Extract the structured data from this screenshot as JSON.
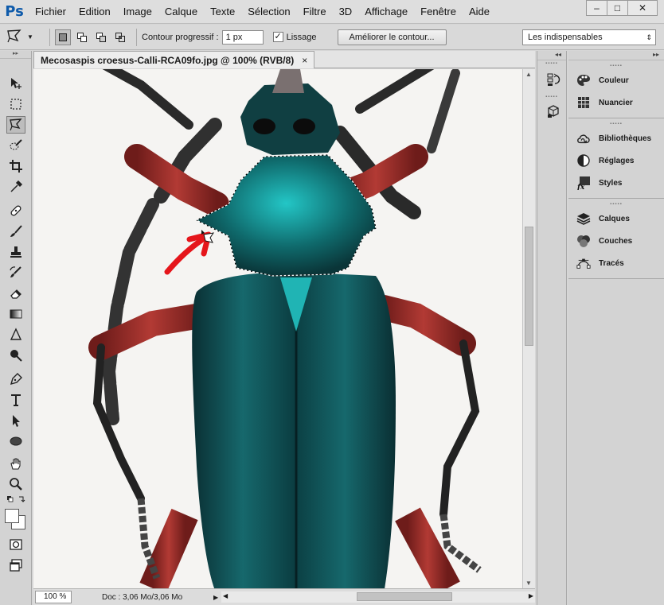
{
  "app": {
    "logo": "Ps"
  },
  "menu": [
    "Fichier",
    "Edition",
    "Image",
    "Calque",
    "Texte",
    "Sélection",
    "Filtre",
    "3D",
    "Affichage",
    "Fenêtre",
    "Aide"
  ],
  "window_controls": {
    "minimize": "–",
    "maximize": "□",
    "close": "✕"
  },
  "options": {
    "feather_label": "Contour progressif :",
    "feather_value": "1 px",
    "antialias_label": "Lissage",
    "antialias_checked": "✓",
    "refine_edge_label": "Améliorer le contour...",
    "workspace": "Les indispensables"
  },
  "document": {
    "tab_title": "Mecosaspis croesus-Calli-RCA09fo.jpg @ 100% (RVB/8)",
    "close": "×",
    "zoom": "100 %",
    "doc_info": "Doc : 3,06 Mo/3,06 Mo"
  },
  "panels": {
    "group1": [
      {
        "label": "Couleur",
        "icon": "palette-icon"
      },
      {
        "label": "Nuancier",
        "icon": "swatches-grid-icon"
      }
    ],
    "group2": [
      {
        "label": "Bibliothèques",
        "icon": "libraries-icon"
      },
      {
        "label": "Réglages",
        "icon": "adjustments-icon"
      },
      {
        "label": "Styles",
        "icon": "styles-fx-icon"
      }
    ],
    "group3": [
      {
        "label": "Calques",
        "icon": "layers-icon"
      },
      {
        "label": "Couches",
        "icon": "channels-icon"
      },
      {
        "label": "Tracés",
        "icon": "paths-icon"
      }
    ]
  },
  "colors": {
    "beetle_body": "#0d4a4e",
    "beetle_highlight": "#1fc7c7",
    "legs": "#8c2b27",
    "annotation_arrow": "#e5151b",
    "ps_blue": "#0f5bab"
  }
}
